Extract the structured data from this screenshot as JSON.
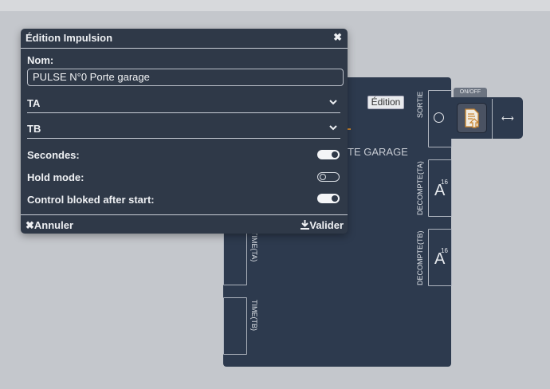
{
  "modal": {
    "title": "Édition Impulsion",
    "name_label": "Nom:",
    "name_value": "PULSE N°0 Porte garage",
    "select_ta": "TA",
    "select_tb": "TB",
    "toggles": [
      {
        "label": "Secondes:",
        "on": true
      },
      {
        "label": "Hold mode:",
        "on": false
      },
      {
        "label": "Control bloked after start:",
        "on": true
      }
    ],
    "cancel_label": "Annuler",
    "validate_label": "Valider"
  },
  "widget": {
    "edit_button": "Édition",
    "title_fragment": "TE GARAGE",
    "sortie_label": "SORTIE",
    "decompte_ta_label": "DECOMPTE(TA)",
    "decompte_tb_label": "DECOMPTE(TB)",
    "decompte_ta_value": "A",
    "decompte_ta_exp": "16",
    "decompte_tb_value": "A",
    "decompte_tb_exp": "16",
    "time_ta_label": "TIME(TA)",
    "time_tb_label": "TIME(TB)",
    "onoff_label": "ON/OFF",
    "accent_color": "#c8832c"
  },
  "icons": [
    "close-icon",
    "chevron-down-icon",
    "cancel-x-icon",
    "download-icon",
    "document-upload-icon",
    "resize-arrow-icon",
    "circle-indicator-icon"
  ]
}
